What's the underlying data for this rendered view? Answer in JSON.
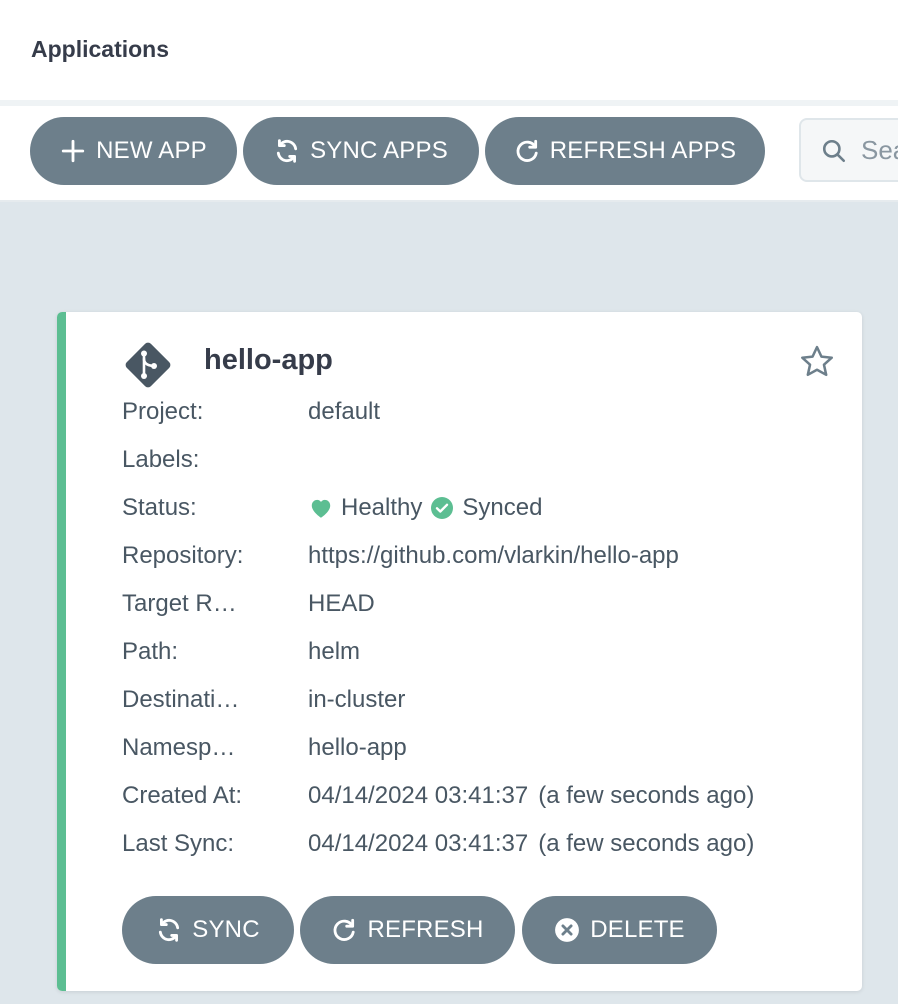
{
  "header": {
    "title": "Applications"
  },
  "toolbar": {
    "new_app": "NEW APP",
    "sync_apps": "SYNC APPS",
    "refresh_apps": "REFRESH APPS",
    "search_placeholder": "Search applications..."
  },
  "app": {
    "name": "hello-app",
    "accent_color": "#5cbe92",
    "fields": {
      "project": {
        "label": "Project:",
        "value": "default"
      },
      "labels": {
        "label": "Labels:",
        "value": ""
      },
      "status": {
        "label": "Status:",
        "health": "Healthy",
        "sync": "Synced",
        "health_color": "#5cbe92"
      },
      "repository": {
        "label": "Repository:",
        "value": "https://github.com/vlarkin/hello-app"
      },
      "target_revision": {
        "label": "Target Revision:",
        "value": "HEAD"
      },
      "path": {
        "label": "Path:",
        "value": "helm"
      },
      "destination": {
        "label": "Destination:",
        "value": "in-cluster"
      },
      "namespace": {
        "label": "Namespace:",
        "value": "hello-app"
      },
      "created_at": {
        "label": "Created At:",
        "value": "04/14/2024 03:41:37",
        "ago": "(a few seconds ago)"
      },
      "last_sync": {
        "label": "Last Sync:",
        "value": "04/14/2024 03:41:37",
        "ago": "(a few seconds ago)"
      }
    },
    "actions": {
      "sync": "SYNC",
      "refresh": "REFRESH",
      "delete": "DELETE"
    }
  },
  "icons": {
    "new_app": "plus-icon",
    "sync": "sync-icon",
    "refresh": "refresh-icon",
    "delete": "times-circle-icon",
    "search": "search-icon",
    "app": "git-icon",
    "favorite": "star-icon",
    "health": "heart-icon",
    "synced": "check-circle-icon"
  }
}
